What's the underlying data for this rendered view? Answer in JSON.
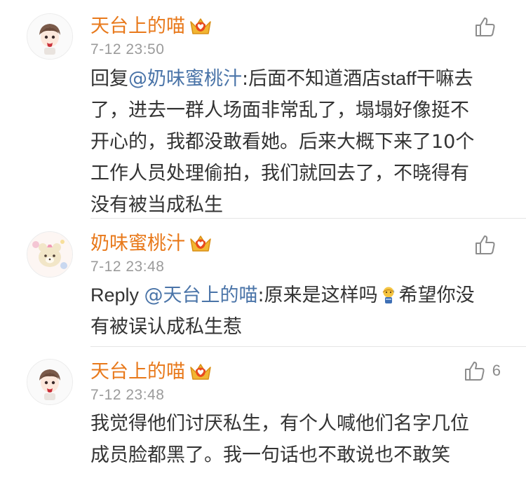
{
  "comments": [
    {
      "username": "天台上的喵",
      "time": "7-12 23:50",
      "reply_prefix": "回复",
      "mention": "@奶味蜜桃汁",
      "lines": [
        ":后面不知道酒店",
        "staff",
        "干嘛去",
        "了，进去一群人场面非常乱了，塌塌好像挺不",
        "开心的，我都没敢看她。后来大概下来了10个",
        "工作人员处理偷拍，我们就回去了，不晓得有",
        "没有被当成私生"
      ],
      "likes": ""
    },
    {
      "username": "奶味蜜桃汁",
      "time": "7-12 23:48",
      "reply_prefix": "Reply ",
      "mention": "@天台上的喵",
      "lines": [
        ":原来是这样吗",
        "希望你没",
        "有被误认成私生惹"
      ],
      "likes": ""
    },
    {
      "username": "天台上的喵",
      "time": "7-12 23:48",
      "lines": [
        "我觉得他们讨厌私生，有个人喊他们名字几位",
        "成员脸都黑了。我一句话也不敢说也不敢笑"
      ],
      "likes": "6"
    }
  ],
  "colors": {
    "username": "#e8791b",
    "mention": "#4a74a8",
    "text": "#333333",
    "timestamp": "#9b9b9b",
    "crown": "#f2b632"
  },
  "icons": {
    "like": "thumbs-up-icon",
    "badge": "crown-badge-icon",
    "emoji": "sweat-emoji-icon"
  }
}
